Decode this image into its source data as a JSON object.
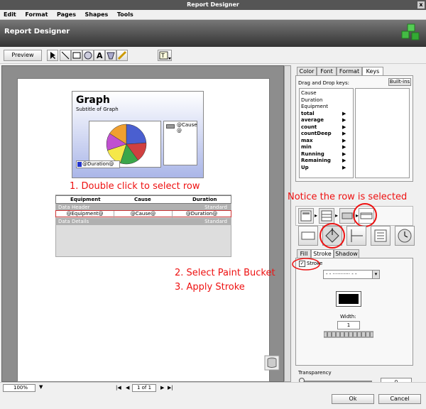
{
  "window": {
    "title": "Report Designer",
    "close": "x"
  },
  "menu": [
    "Edit",
    "Format",
    "Pages",
    "Shapes",
    "Tools"
  ],
  "header": {
    "title": "Report Designer"
  },
  "toolbar": {
    "preview_label": "Preview"
  },
  "graph": {
    "title": "Graph",
    "subtitle": "Subtitle of Graph",
    "duration_label": "@Duration@",
    "legend_label": "@Cause @"
  },
  "table": {
    "columns": [
      "Equipment",
      "Cause",
      "Duration"
    ],
    "header_band": "Data Header",
    "header_band_right": "Standard",
    "row": [
      "@Equipment@",
      "@Cause@",
      "@Duration@"
    ],
    "details_band": "Data Details",
    "details_band_right": "Standard"
  },
  "annotations": {
    "a1": "1. Double click to select row",
    "a2": "Notice the row is selected",
    "a3": "2. Select Paint Bucket",
    "a4": "3. Apply Stroke"
  },
  "right_tabs": [
    "Color",
    "Font",
    "Format",
    "Keys"
  ],
  "keys": {
    "label": "Drag and Drop keys:",
    "builtins": "Built-ins",
    "items": [
      "Cause",
      "Duration",
      "Equipment"
    ],
    "bold_items": [
      "total",
      "average",
      "count",
      "countDeep",
      "max",
      "min",
      "Running",
      "Remaining",
      "Up"
    ],
    "arrow": "▶"
  },
  "style_tabs": [
    "Fill",
    "Stroke",
    "Shadow"
  ],
  "stroke": {
    "checkbox_label": "Stroke",
    "checkbox_mark": "✓",
    "line_style": "- - ··········· - -",
    "dropdown_arrow": "▾",
    "width_label": "Width:",
    "width_value": "1"
  },
  "transparency": {
    "label": "Transparency",
    "value": "0"
  },
  "bottom": {
    "zoom": "100%",
    "zoom_arrow": "▼",
    "page": "1 of 1",
    "ok": "Ok",
    "cancel": "Cancel",
    "nav_first": "|◀",
    "nav_prev": "◀",
    "nav_next": "▶",
    "nav_last": "▶|"
  },
  "colors": {
    "annotation": "#ee1111",
    "pie": [
      "#4a5fd0",
      "#d04040",
      "#3aa64a",
      "#f5e84a",
      "#c050d0",
      "#f0a030"
    ]
  }
}
